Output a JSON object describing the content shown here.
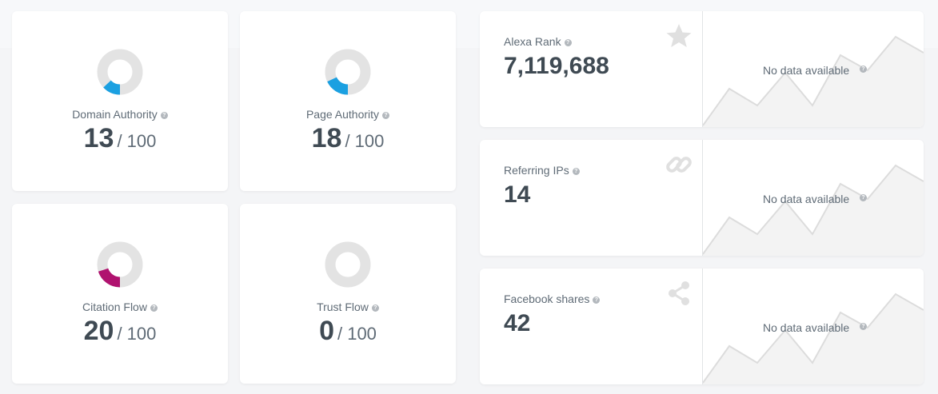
{
  "metrics": [
    {
      "label": "Domain Authority",
      "value": "13",
      "denominator": "/ 100",
      "percent": 13,
      "color": "#1ba0e1"
    },
    {
      "label": "Page Authority",
      "value": "18",
      "denominator": "/ 100",
      "percent": 18,
      "color": "#1ba0e1"
    },
    {
      "label": "Citation Flow",
      "value": "20",
      "denominator": "/ 100",
      "percent": 20,
      "color": "#b0126f"
    },
    {
      "label": "Trust Flow",
      "value": "0",
      "denominator": "/ 100",
      "percent": 0,
      "color": "#b0126f"
    }
  ],
  "stats": [
    {
      "label": "Alexa Rank",
      "value": "7,119,688",
      "icon": "star-icon",
      "no_data": "No data available"
    },
    {
      "label": "Referring IPs",
      "value": "14",
      "icon": "link-icon",
      "no_data": "No data available"
    },
    {
      "label": "Facebook shares",
      "value": "42",
      "icon": "share-icon",
      "no_data": "No data available"
    }
  ],
  "help_glyph": "?",
  "colors": {
    "donut_track": "#e3e3e3",
    "placeholder_chart": "#f3f3f3",
    "icon_gray": "#e0e0e0"
  }
}
